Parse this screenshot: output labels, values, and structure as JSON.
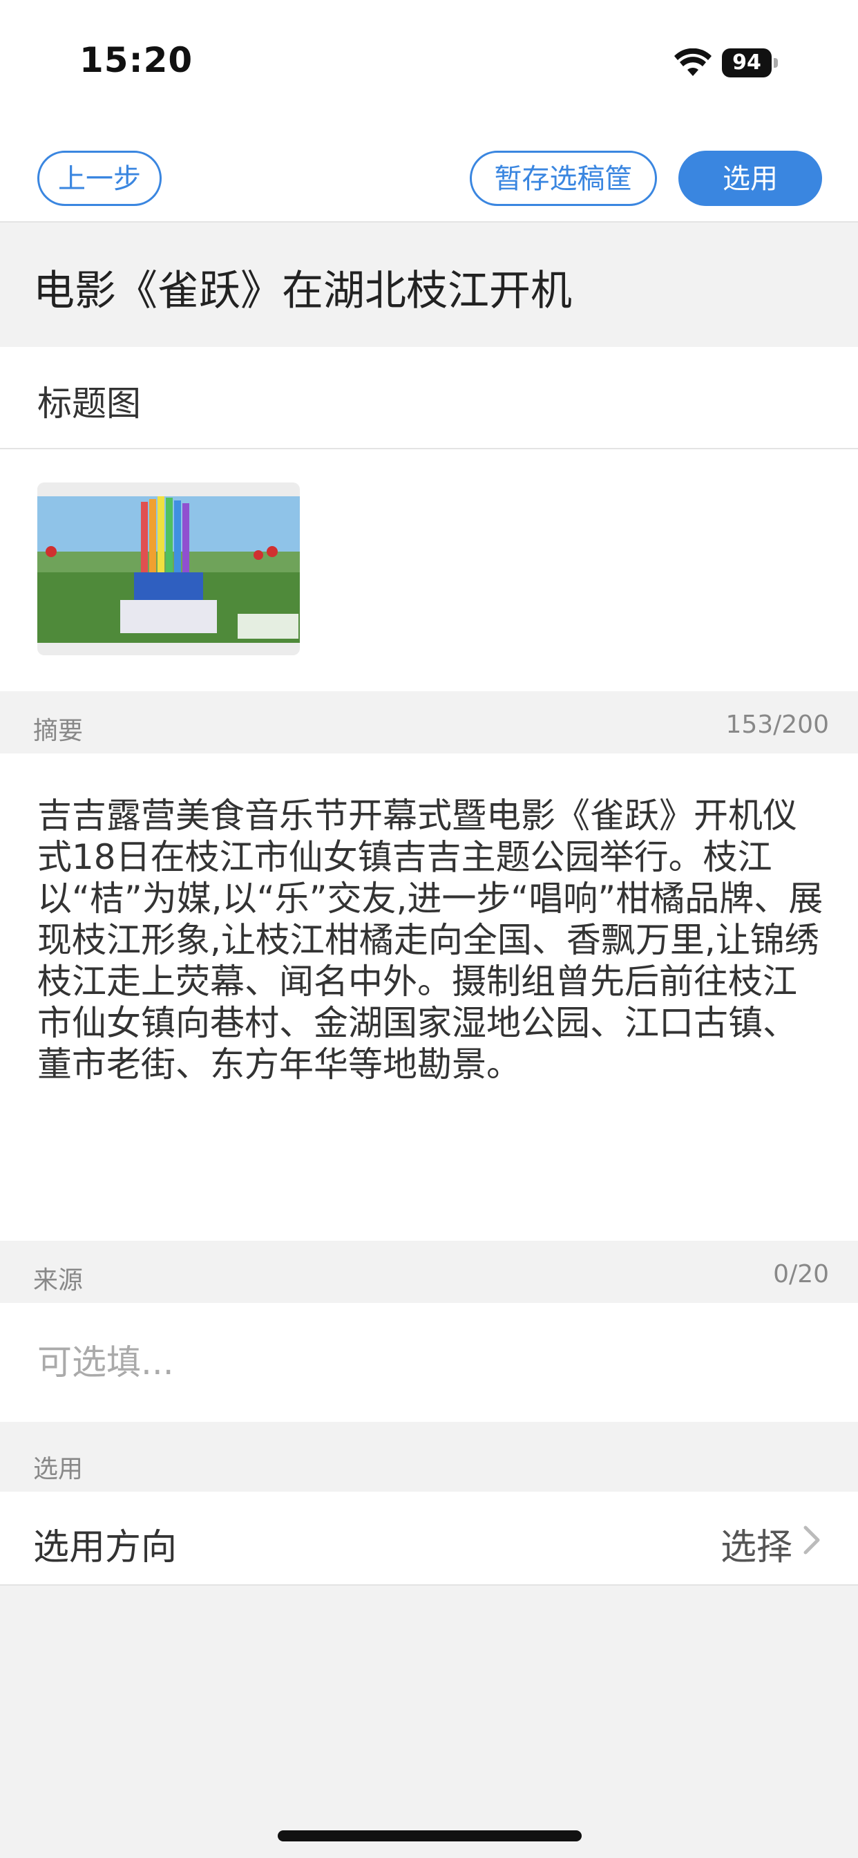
{
  "status_bar": {
    "time": "15:20",
    "battery": "94",
    "icons": [
      "wifi-icon",
      "battery-icon"
    ]
  },
  "toolbar": {
    "prev_label": "上一步",
    "save_label": "暂存选稿筐",
    "use_label": "选用",
    "accent_color": "#3a86e0"
  },
  "article": {
    "title": "电影《雀跃》在湖北枝江开机"
  },
  "cover": {
    "label": "标题图"
  },
  "summary": {
    "label": "摘要",
    "count": "153/200",
    "text": "吉吉露营美食音乐节开幕式暨电影《雀跃》开机仪式18日在枝江市仙女镇吉吉主题公园举行。枝江以“桔”为媒,以“乐”交友,进一步“唱响”柑橘品牌、展现枝江形象,让枝江柑橘走向全国、香飘万里,让锦绣枝江走上荧幕、闻名中外。摄制组曾先后前往枝江市仙女镇向巷村、金湖国家湿地公园、江口古镇、董市老街、东方年华等地勘景。"
  },
  "source": {
    "label": "来源",
    "count": "0/20",
    "placeholder": "可选填...",
    "value": ""
  },
  "usage": {
    "section_label": "选用",
    "direction_label": "选用方向",
    "direction_value": "选择"
  }
}
